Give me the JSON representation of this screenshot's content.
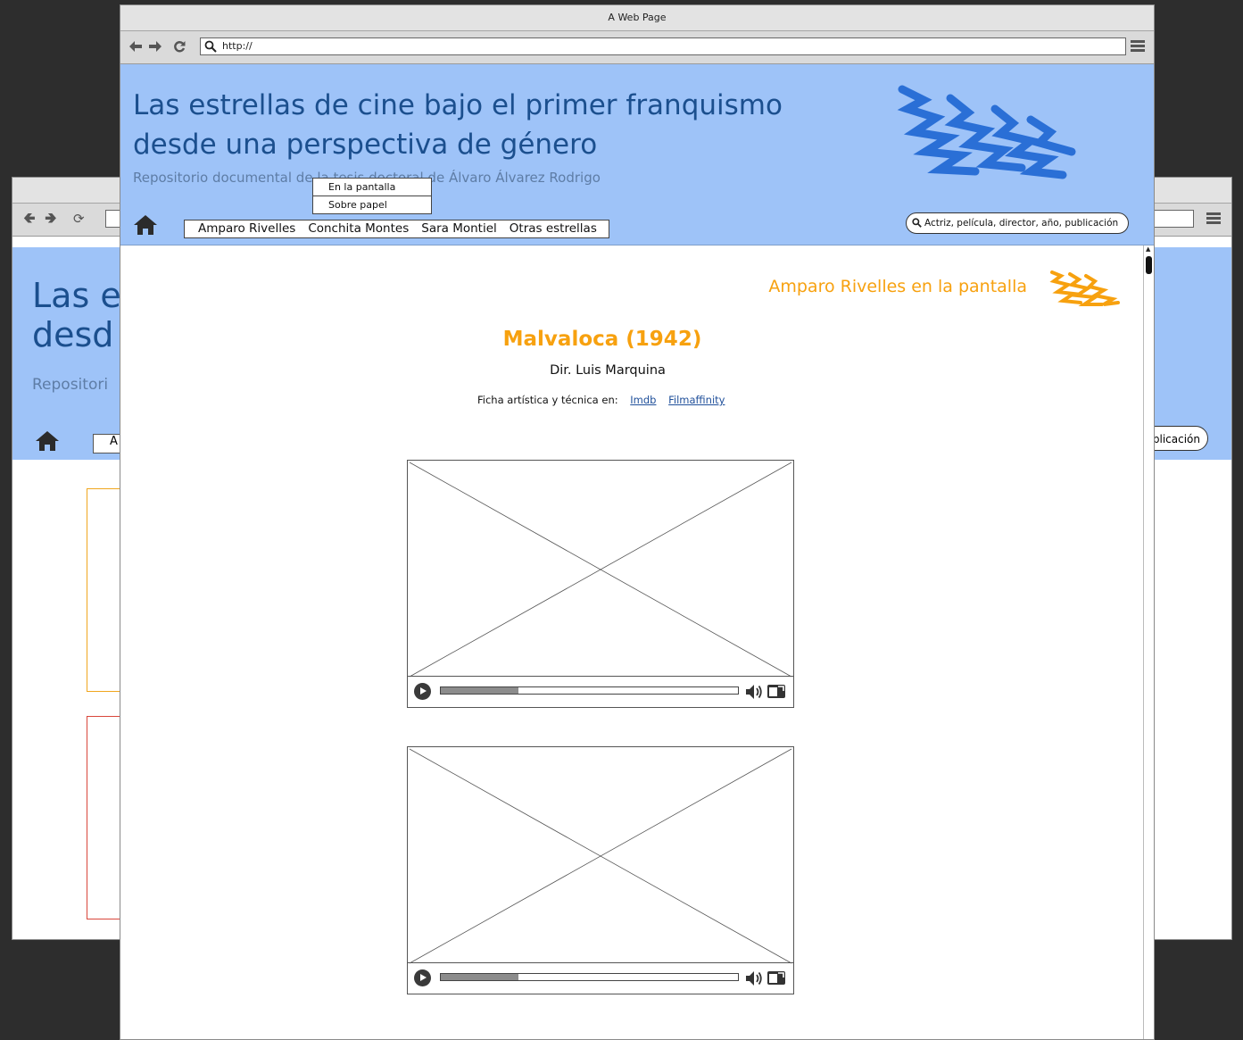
{
  "colors": {
    "header_bg": "#9ec3f8",
    "title_blue": "#1b4f8e",
    "accent_orange": "#f7a10f",
    "scribble_blue": "#2a6fd6",
    "link_blue": "#1f4f9a"
  },
  "browser": {
    "window_title": "A Web Page",
    "url": "http://",
    "back_icon": "back-arrow-icon",
    "forward_icon": "forward-arrow-icon",
    "reload_icon": "reload-icon",
    "menu_icon": "hamburger-icon"
  },
  "back_window": {
    "title_line1": "Las e",
    "title_line2": "desd",
    "subtitle": "Repositori",
    "menu_first": "A",
    "search_tail": "blicación"
  },
  "header": {
    "title_line1": "Las estrellas de cine bajo el primer franquismo",
    "title_line2": "desde una perspectiva de género",
    "subtitle": "Repositorio documental de la tesis doctoral de Álvaro Álvarez Rodrigo"
  },
  "nav": {
    "home_icon": "home-icon",
    "items": [
      "Amparo Rivelles",
      "Conchita Montes",
      "Sara Montiel",
      "Otras estrellas"
    ],
    "dropdown": [
      "En la pantalla",
      "Sobre papel"
    ],
    "search_placeholder": "Actriz, película, director, año, publicación"
  },
  "page": {
    "section_heading": "Amparo Rivelles en la pantalla",
    "film_title": "Malvaloca (1942)",
    "director": "Dir. Luis Marquina",
    "ficha_label": "Ficha artística y técnica en:",
    "links": [
      "Imdb",
      "Filmaffinity"
    ]
  },
  "videos": [
    {
      "progress": 0.26,
      "play_icon": "play-icon",
      "volume_icon": "volume-icon",
      "fullscreen_icon": "fullscreen-icon"
    },
    {
      "progress": 0.26,
      "play_icon": "play-icon",
      "volume_icon": "volume-icon",
      "fullscreen_icon": "fullscreen-icon"
    }
  ]
}
